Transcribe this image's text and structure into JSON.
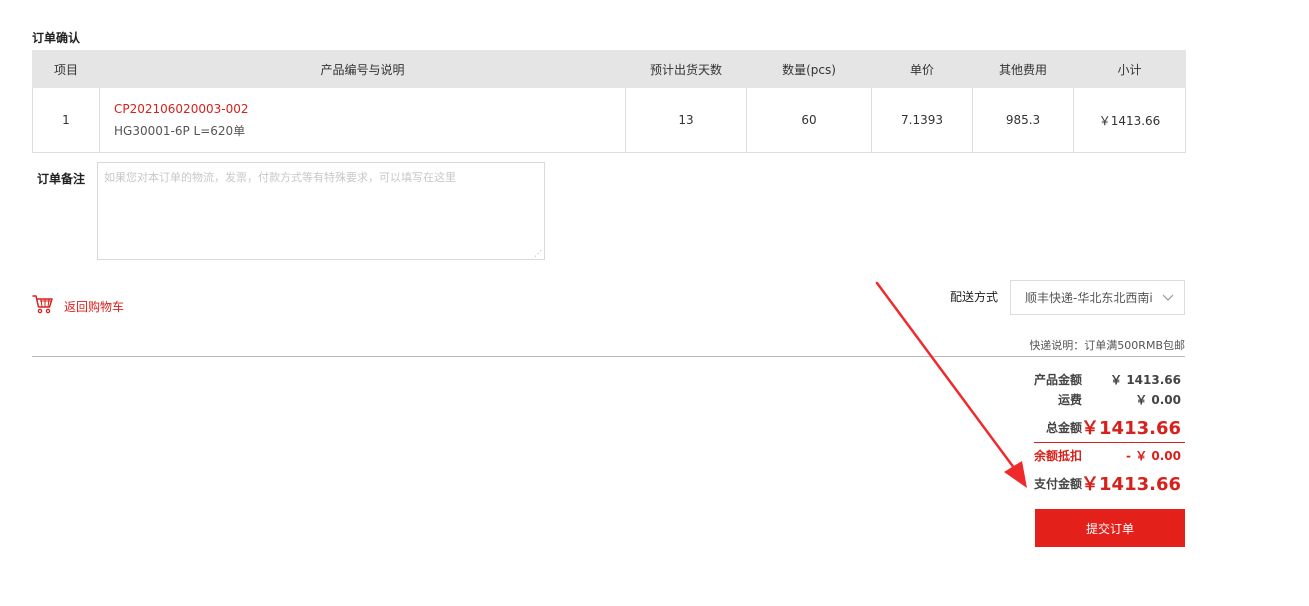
{
  "page": {
    "title": "订单确认"
  },
  "table": {
    "headers": [
      "项目",
      "产品编号与说明",
      "预计出货天数",
      "数量(pcs)",
      "单价",
      "其他费用",
      "小计"
    ],
    "rows": [
      {
        "index": "1",
        "code": "CP202106020003-002",
        "desc": "HG30001-6P L=620单",
        "days": "13",
        "qty": "60",
        "unit_price": "7.1393",
        "other_fee": "985.3",
        "subtotal": "￥1413.66"
      }
    ]
  },
  "remark": {
    "label": "订单备注",
    "placeholder": "如果您对本订单的物流，发票，付款方式等有特殊要求，可以填写在这里"
  },
  "back_cart": {
    "label": "返回购物车",
    "icon": "cart-icon"
  },
  "shipping": {
    "label": "配送方式",
    "selected": "顺丰快递-华北东北西南i",
    "note": "快递说明：订单满500RMB包邮"
  },
  "summary": {
    "product_amount_label": "产品金额",
    "product_amount": "￥ 1413.66",
    "freight_label": "运费",
    "freight": "￥ 0.00",
    "total_label": "总金额",
    "total": "￥1413.66",
    "balance_label": "余额抵扣",
    "balance": "- ￥ 0.00",
    "pay_label": "支付金额",
    "pay": "￥1413.66"
  },
  "submit": {
    "label": "提交订单"
  },
  "colors": {
    "accent": "#e4201b",
    "header_bg": "#e5e5e5",
    "link": "#d7211c"
  }
}
